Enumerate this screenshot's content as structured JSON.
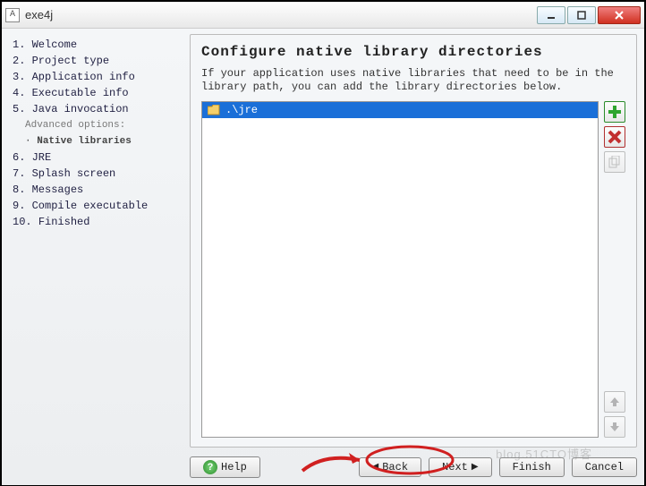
{
  "window": {
    "title": "exe4j",
    "icon_label": "A"
  },
  "sidebar": {
    "steps": [
      {
        "num": "1.",
        "label": "Welcome"
      },
      {
        "num": "2.",
        "label": "Project type"
      },
      {
        "num": "3.",
        "label": "Application info"
      },
      {
        "num": "4.",
        "label": "Executable info"
      },
      {
        "num": "5.",
        "label": "Java invocation"
      }
    ],
    "advanced_note": "Advanced options:",
    "sub": {
      "bullet": "·",
      "label": "Native libraries"
    },
    "steps2": [
      {
        "num": "6.",
        "label": "JRE"
      },
      {
        "num": "7.",
        "label": "Splash screen"
      },
      {
        "num": "8.",
        "label": "Messages"
      },
      {
        "num": "9.",
        "label": "Compile executable"
      },
      {
        "num": "10.",
        "label": "Finished"
      }
    ],
    "brand": "exe4j"
  },
  "panel": {
    "heading": "Configure native library directories",
    "description": "If your application uses native libraries that need to be in the library path, you can add the library directories below.",
    "items": [
      {
        "icon": "folder",
        "path": ".\\jre"
      }
    ],
    "side_buttons": {
      "add": "add-icon",
      "remove": "remove-icon",
      "copy": "copy-icon"
    },
    "reorder": {
      "up": "up-icon",
      "down": "down-icon"
    }
  },
  "buttons": {
    "help": "Help",
    "back": "Back",
    "next": "Next",
    "finish": "Finish",
    "cancel": "Cancel"
  },
  "watermark": "blog.51CTO博客"
}
